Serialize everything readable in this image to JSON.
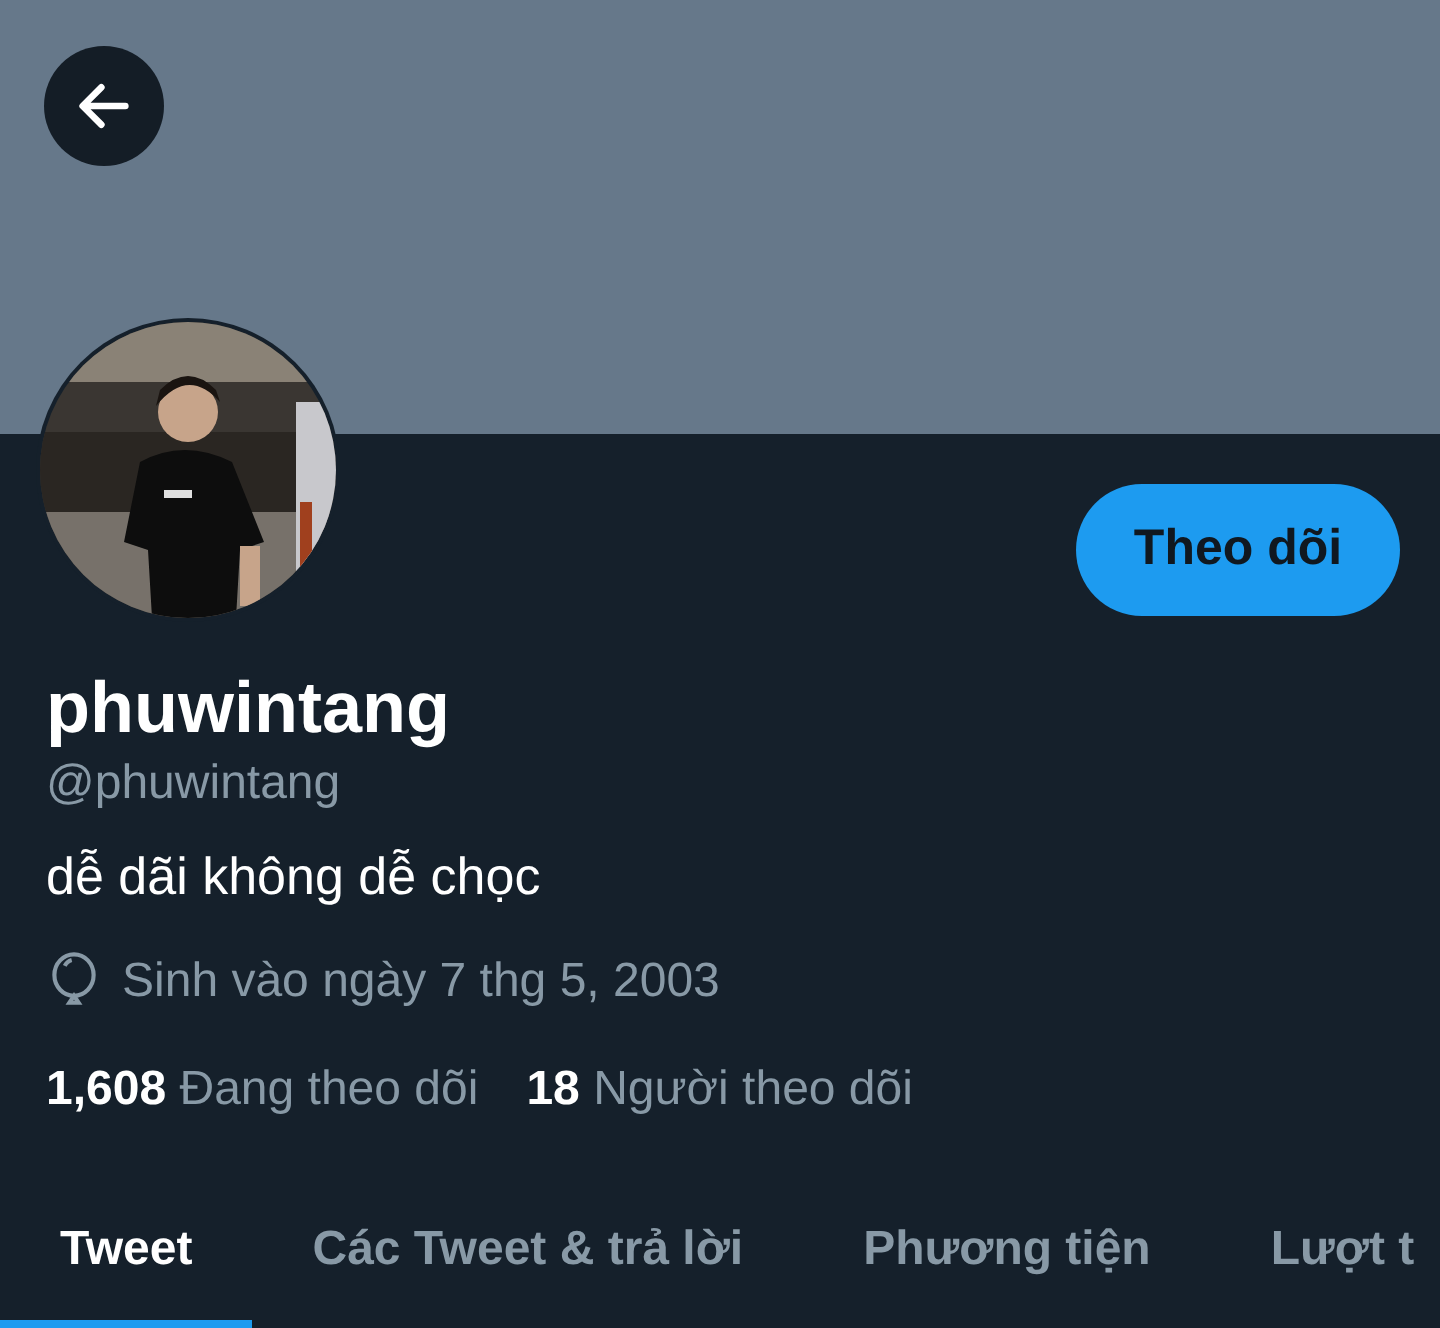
{
  "profile": {
    "follow_button": "Theo dõi",
    "name": "phuwintang",
    "handle": "@phuwintang",
    "bio": "dễ dãi không dễ chọc",
    "birthday": "Sinh vào ngày 7 thg 5, 2003"
  },
  "stats": [
    {
      "count": "1,608",
      "label": "Đang theo dõi"
    },
    {
      "count": "18",
      "label": "Người theo dõi"
    }
  ],
  "tabs": [
    {
      "label": "Tweet",
      "selected": true
    },
    {
      "label": "Các Tweet & trả lời",
      "selected": false
    },
    {
      "label": "Phương tiện",
      "selected": false
    },
    {
      "label": "Lượt t",
      "selected": false
    }
  ]
}
